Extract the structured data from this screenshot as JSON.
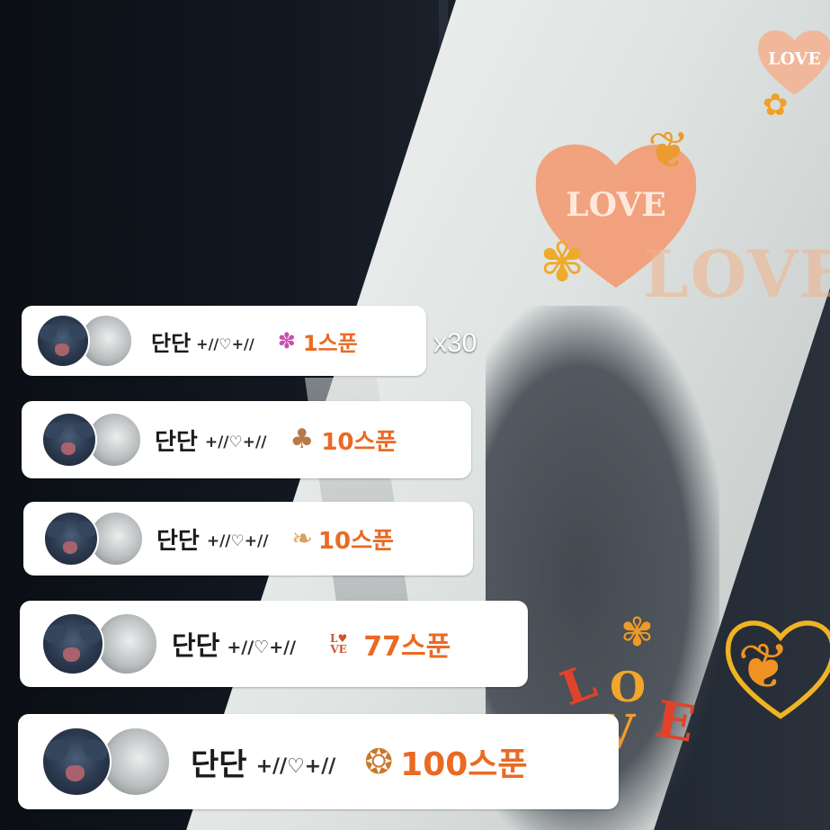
{
  "background": {
    "love_text": "LOVE",
    "love_fill": "#f3a57d",
    "gold_heart": "#f0b323"
  },
  "gifts": [
    {
      "name": "단단",
      "deco": "+//♡+//",
      "gift_icon": "pink-octopus-icon",
      "amount": "1스푼",
      "combo": "x30"
    },
    {
      "name": "단단",
      "deco": "+//♡+//",
      "gift_icon": "mushroom-icon",
      "amount": "10스푼"
    },
    {
      "name": "단단",
      "deco": "+//♡+//",
      "gift_icon": "cat-on-book-icon",
      "amount": "10스푼"
    },
    {
      "name": "단단",
      "deco": "+//♡+//",
      "gift_icon": "love-letters-icon",
      "amount": "77스푼"
    },
    {
      "name": "단단",
      "deco": "+//♡+//",
      "gift_icon": "autumn-basket-icon",
      "amount": "100스푼"
    }
  ],
  "colors": {
    "accent": "#ea6a24",
    "card_bg": "#ffffff",
    "name_text": "#1b1b1b"
  }
}
